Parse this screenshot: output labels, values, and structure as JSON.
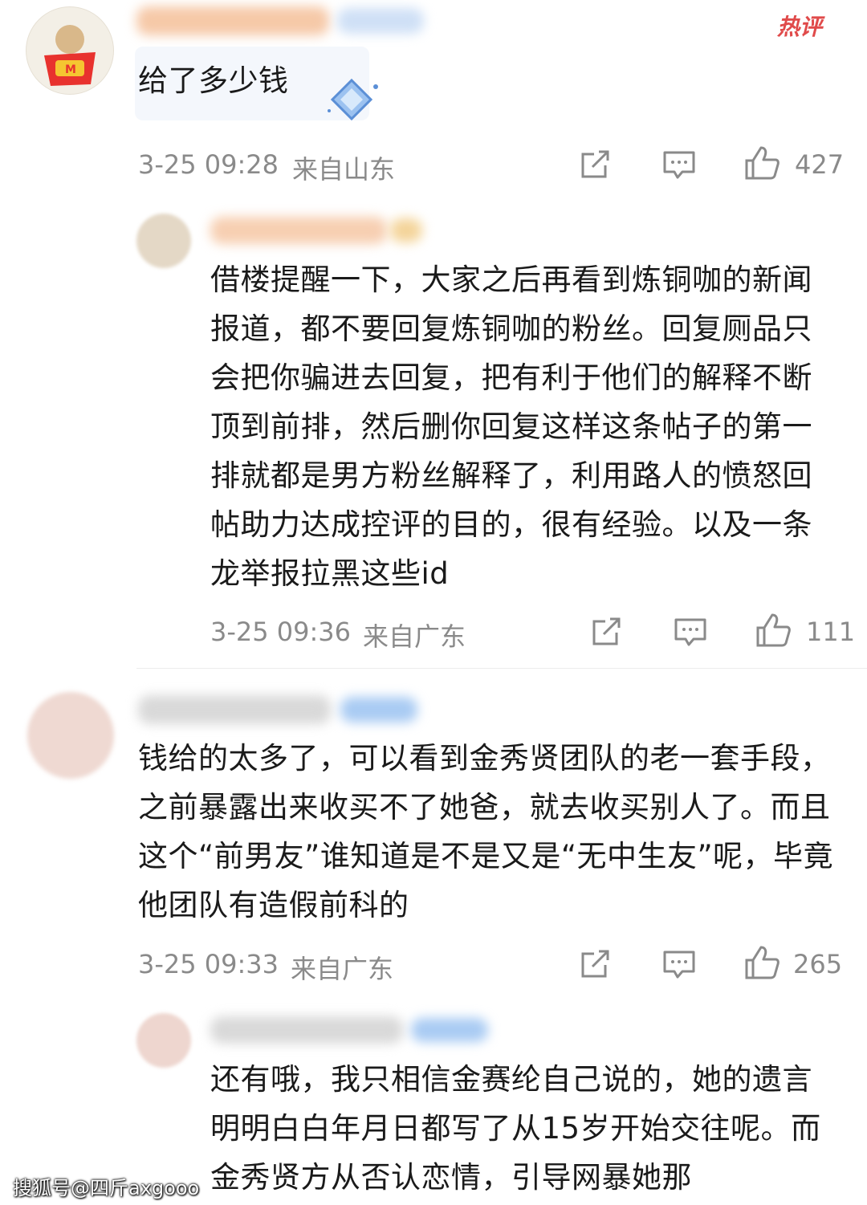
{
  "comments": [
    {
      "text": "给了多少钱",
      "time": "3-25 09:28",
      "location": "来自山东",
      "likes": "427",
      "hot_badge": "热评"
    },
    {
      "text": "借楼提醒一下，大家之后再看到炼铜咖的新闻报道，都不要回复炼铜咖的粉丝。回复厕品只会把你骗进去回复，把有利于他们的解释不断顶到前排，然后删你回复这样这条帖子的第一排就都是男方粉丝解释了，利用路人的愤怒回帖助力达成控评的目的，很有经验。以及一条龙举报拉黑这些id",
      "time": "3-25 09:36",
      "location": "来自广东",
      "likes": "111"
    },
    {
      "text": "钱给的太多了，可以看到金秀贤团队的老一套手段，之前暴露出来收买不了她爸，就去收买别人了。而且这个“前男友”谁知道是不是又是“无中生友”呢，毕竟他团队有造假前科的",
      "time": "3-25 09:33",
      "location": "来自广东",
      "likes": "265"
    },
    {
      "text": "还有哦，我只相信金赛纶自己说的，她的遗言明明白白年月日都写了从15岁开始交往呢。而金秀贤方从否认恋情，引导网暴她那"
    }
  ],
  "watermark": "搜狐号@四斤axgooo",
  "colors": {
    "meta_gray": "#8a8a8a",
    "hot_red": "#e04a4a",
    "divider": "#ececec"
  },
  "icons": [
    "share-icon",
    "comment-icon",
    "like-icon"
  ]
}
